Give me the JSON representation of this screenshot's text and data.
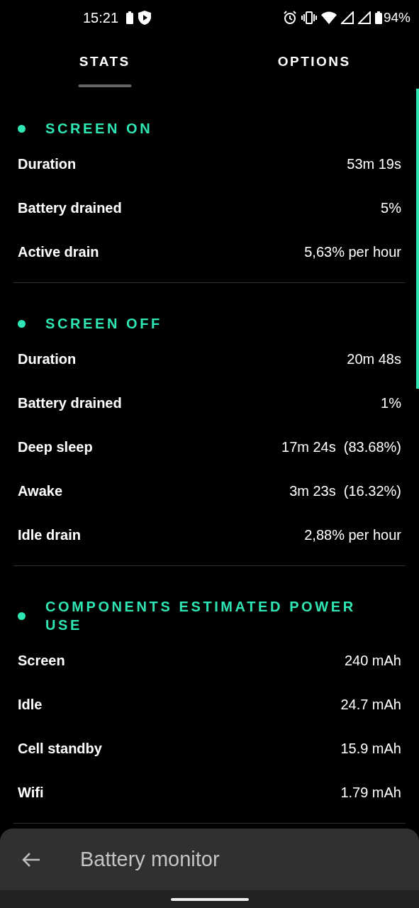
{
  "status_bar": {
    "time": "15:21",
    "battery": "94%"
  },
  "tabs": [
    {
      "label": "STATS",
      "selected": true
    },
    {
      "label": "OPTIONS",
      "selected": false
    }
  ],
  "sections": [
    {
      "title": "SCREEN ON",
      "rows": [
        {
          "label": "Duration",
          "value": "53m 19s"
        },
        {
          "label": "Battery drained",
          "value": "5%"
        },
        {
          "label": "Active drain",
          "value": "5,63% per hour"
        }
      ]
    },
    {
      "title": "SCREEN OFF",
      "rows": [
        {
          "label": "Duration",
          "value": "20m 48s"
        },
        {
          "label": "Battery drained",
          "value": "1%"
        },
        {
          "label": "Deep sleep",
          "value": "17m 24s  (83.68%)"
        },
        {
          "label": "Awake",
          "value": "3m 23s  (16.32%)"
        },
        {
          "label": "Idle drain",
          "value": "2,88% per hour"
        }
      ]
    },
    {
      "title": "COMPONENTS ESTIMATED POWER USE",
      "rows": [
        {
          "label": "Screen",
          "value": "240 mAh"
        },
        {
          "label": "Idle",
          "value": "24.7 mAh"
        },
        {
          "label": "Cell standby",
          "value": "15.9 mAh"
        },
        {
          "label": "Wifi",
          "value": "1.79 mAh"
        }
      ]
    }
  ],
  "app_bar": {
    "title": "Battery monitor"
  }
}
